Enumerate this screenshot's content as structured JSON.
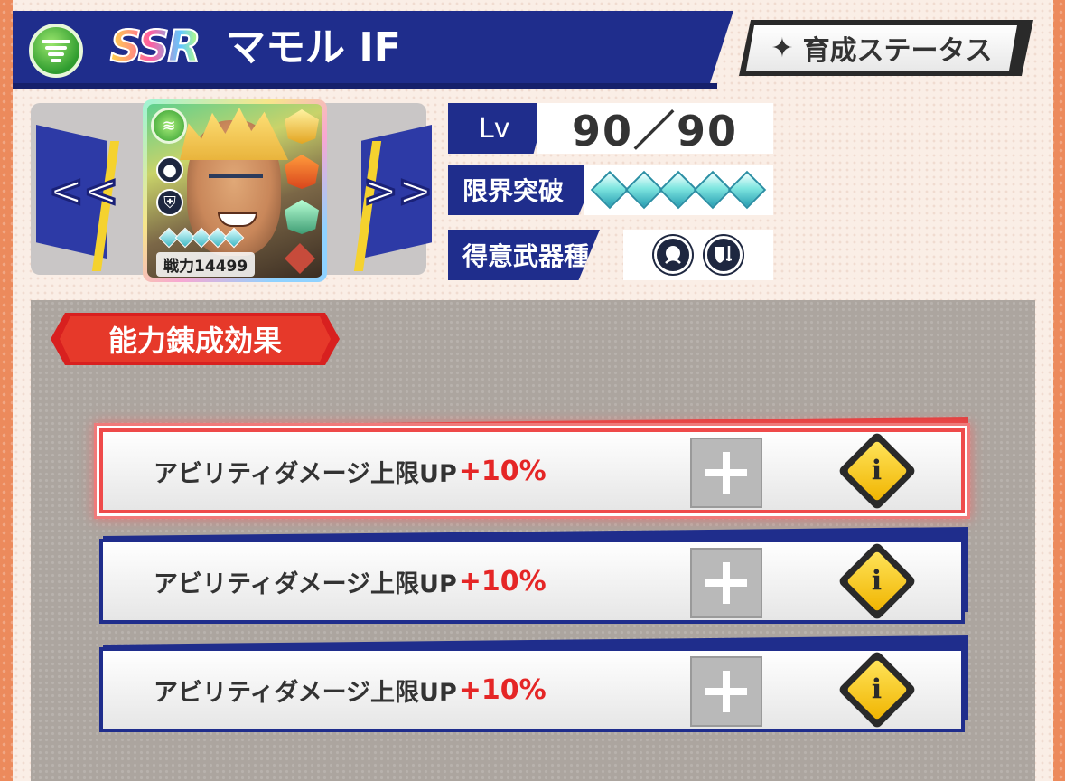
{
  "header": {
    "element_icon": "wind-element-icon",
    "rarity": "SSR",
    "character_name": "マモル IF",
    "status_button_label": "育成ステータス",
    "status_button_icon": "sparkle-icon"
  },
  "character_card": {
    "power_label": "戦力14499",
    "navigation": {
      "prev_label": "<<",
      "next_label": ">>"
    }
  },
  "stats": {
    "level": {
      "label": "Lv",
      "value": "90／90"
    },
    "limit_break": {
      "label": "限界突破",
      "filled": 5,
      "total": 5
    },
    "weapon_type": {
      "label": "得意武器種",
      "icons": [
        "magic-orb-icon",
        "sword-shield-icon"
      ]
    }
  },
  "section": {
    "title": "能力錬成効果",
    "abilities": [
      {
        "text": "アビリティダメージ上限UP",
        "bonus": "+10%",
        "selected": true
      },
      {
        "text": "アビリティダメージ上限UP",
        "bonus": "+10%",
        "selected": false
      },
      {
        "text": "アビリティダメージ上限UP",
        "bonus": "+10%",
        "selected": false
      }
    ],
    "info_label": "i"
  },
  "colors": {
    "navy": "#1f2d8c",
    "accent_red": "#e6392a",
    "bonus_red": "#e52626",
    "info_yellow": "#ffd21e"
  }
}
